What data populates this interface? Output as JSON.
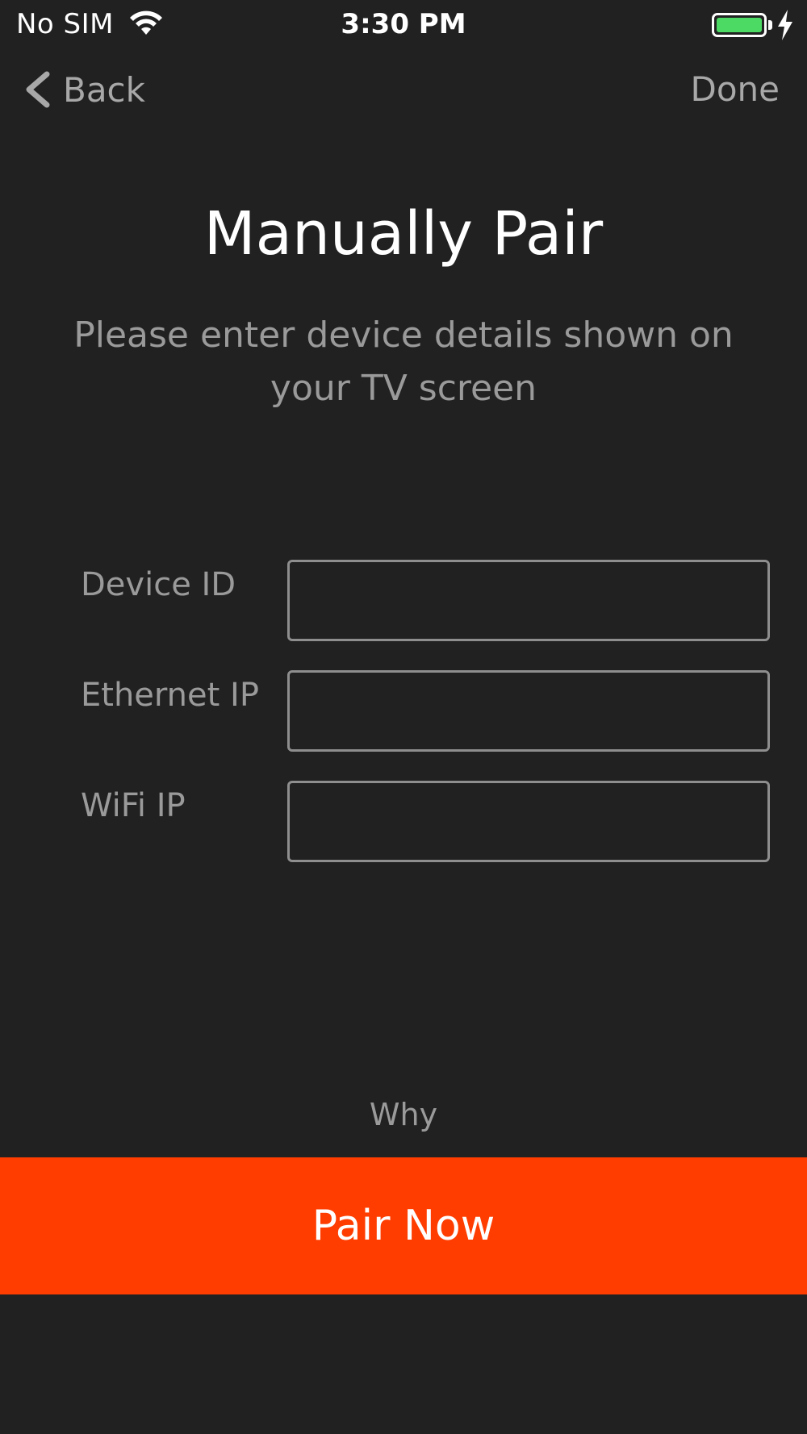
{
  "status_bar": {
    "carrier": "No SIM",
    "time": "3:30 PM",
    "battery_level": 1.0,
    "charging": true,
    "icons": [
      "wifi-icon",
      "battery-icon",
      "charging-bolt-icon"
    ]
  },
  "nav": {
    "back_label": "Back",
    "done_label": "Done",
    "icons": [
      "chevron-left-icon"
    ]
  },
  "header": {
    "title": "Manually Pair",
    "subtitle": "Please enter device details shown on your TV screen"
  },
  "form": {
    "fields": [
      {
        "label": "Device ID",
        "value": "",
        "placeholder": ""
      },
      {
        "label": "Ethernet IP",
        "value": "",
        "placeholder": ""
      },
      {
        "label": "WiFi IP",
        "value": "",
        "placeholder": ""
      }
    ]
  },
  "footer": {
    "why_label": "Why",
    "pair_button_label": "Pair Now"
  },
  "colors": {
    "background": "#212121",
    "accent": "#ff3d00",
    "muted_text": "#9a9a9a",
    "battery": "#4cd964"
  }
}
